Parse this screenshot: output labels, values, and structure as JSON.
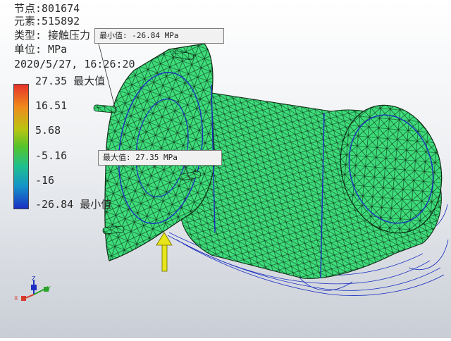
{
  "info": {
    "nodes": "节点:801674",
    "elements": "元素:515892",
    "type": "类型: 接触压力 I",
    "unit": "单位: MPa",
    "timestamp": "2020/5/27, 16:26:20"
  },
  "legend": {
    "labels": [
      "27.35 最大值",
      "16.51",
      "5.68",
      "-5.16",
      "-16",
      "-26.84 最小值"
    ],
    "colors": [
      "#e5332a",
      "#f08a1c",
      "#b9c412",
      "#55c42a",
      "#1ec08e",
      "#1493c9",
      "#1b2fc4"
    ]
  },
  "callouts": {
    "min": "最小值: -26.84 MPa",
    "max": "最大值: 27.35 MPa"
  },
  "triad": {
    "x": "X",
    "y": "Y",
    "z": "Z"
  },
  "colors": {
    "mesh_fill": "#3ddc7a",
    "mesh_line": "#0d2a14",
    "wire": "#1a2fc0",
    "load_arrow": "#e8e61a"
  }
}
